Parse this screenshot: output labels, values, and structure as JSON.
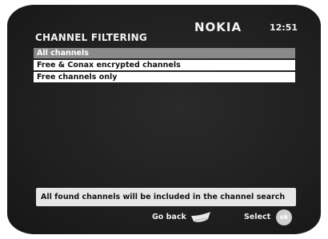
{
  "header": {
    "title": "CHANNEL FILTERING",
    "brand": "NOKIA",
    "clock": "12:51"
  },
  "menu": {
    "items": [
      {
        "label": "All channels",
        "selected": true
      },
      {
        "label": "Free & Conax encrypted channels",
        "selected": false
      },
      {
        "label": "Free channels only",
        "selected": false
      }
    ]
  },
  "info": {
    "text": "All found channels will be included in the channel search"
  },
  "footer": {
    "go_back_label": "Go back",
    "select_label": "Select",
    "ok_icon_text": "ok"
  },
  "colors": {
    "screen_background": "#1f1f1f",
    "highlight": "#8a8a8a",
    "menu_item_background": "#ffffff",
    "info_background": "#e6e6e6"
  }
}
